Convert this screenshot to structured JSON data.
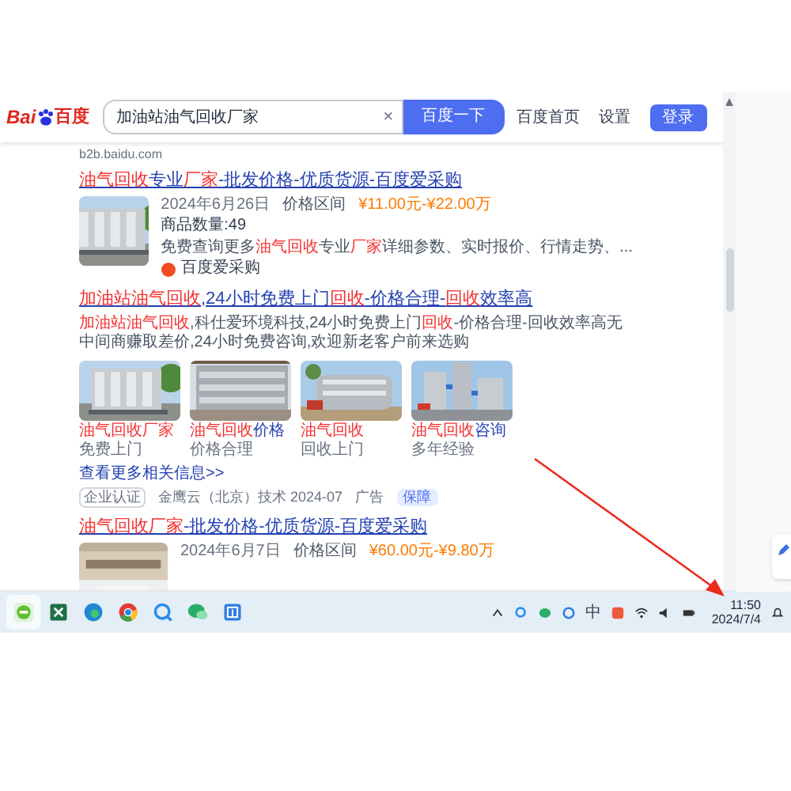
{
  "header": {
    "logo": {
      "left": "Bai",
      "right": "百度"
    },
    "search": {
      "value": "加油站油气回收厂家",
      "clear": "×",
      "button": "百度一下"
    },
    "links": [
      "百度首页",
      "设置"
    ],
    "login": "登录"
  },
  "source_line": "b2b.baidu.com",
  "results": [
    {
      "kind": "product",
      "title": [
        {
          "text": "油气回收",
          "highlight": true
        },
        {
          "text": "专业",
          "highlight": false
        },
        {
          "text": "厂家",
          "highlight": true
        },
        {
          "text": "-批发价格-优质货源-百度爱采购",
          "highlight": false
        }
      ],
      "date": "2024年6月26日",
      "price_label": "价格区间",
      "price": "¥11.00元-¥22.00万",
      "count": "商品数量:49",
      "description": [
        {
          "text": "免费查询更多",
          "highlight": false
        },
        {
          "text": "油气回收",
          "highlight": true
        },
        {
          "text": "专业",
          "highlight": false
        },
        {
          "text": "厂家",
          "highlight": true
        },
        {
          "text": "详细参数、实时报价、行情走势、...",
          "highlight": false
        }
      ],
      "source": "百度爱采购"
    },
    {
      "kind": "ad",
      "title": [
        {
          "text": "加油站油气回收",
          "highlight": true
        },
        {
          "text": ",24小时免费上门",
          "highlight": false
        },
        {
          "text": "回收",
          "highlight": true
        },
        {
          "text": "-价格合理-",
          "highlight": false
        },
        {
          "text": "回收",
          "highlight": true
        },
        {
          "text": "效率高",
          "highlight": false
        }
      ],
      "description": [
        {
          "text": "加油站油气回收",
          "highlight": true
        },
        {
          "text": ",科仕爱环境科技,24小时免费上门",
          "highlight": false
        },
        {
          "text": "回收",
          "highlight": true
        },
        {
          "text": "-价格合理-回收效率高无中间商赚取差价,24小时免费咨询,欢迎新老客户前来选购",
          "highlight": false
        }
      ],
      "gallery": [
        {
          "caption": [
            {
              "text": "油气回收厂家",
              "highlight": true
            }
          ],
          "sub": "免费上门"
        },
        {
          "caption": [
            {
              "text": "油气回收",
              "highlight": true
            },
            {
              "text": "价格",
              "highlight": false
            }
          ],
          "sub": "价格合理"
        },
        {
          "caption": [
            {
              "text": "油气回收",
              "highlight": true
            }
          ],
          "sub": "回收上门"
        },
        {
          "caption": [
            {
              "text": "油气回收",
              "highlight": true
            },
            {
              "text": "咨询",
              "highlight": false
            }
          ],
          "sub": "多年经验"
        }
      ],
      "more_link": "查看更多相关信息>>",
      "badge": "企业认证",
      "advertiser": "金鹰云（北京）技术 2024-07",
      "ad_label": "广告",
      "guarantee": "保障"
    },
    {
      "kind": "product",
      "title": [
        {
          "text": "油气回收厂家",
          "highlight": true
        },
        {
          "text": "-批发价格-优质货源-百度爱采购",
          "highlight": false
        }
      ],
      "date": "2024年6月7日",
      "price_label": "价格区间",
      "price": "¥60.00元-¥9.80万"
    }
  ],
  "taskbar": {
    "ime": "中",
    "time": "11:50",
    "date": "2024/7/4"
  }
}
